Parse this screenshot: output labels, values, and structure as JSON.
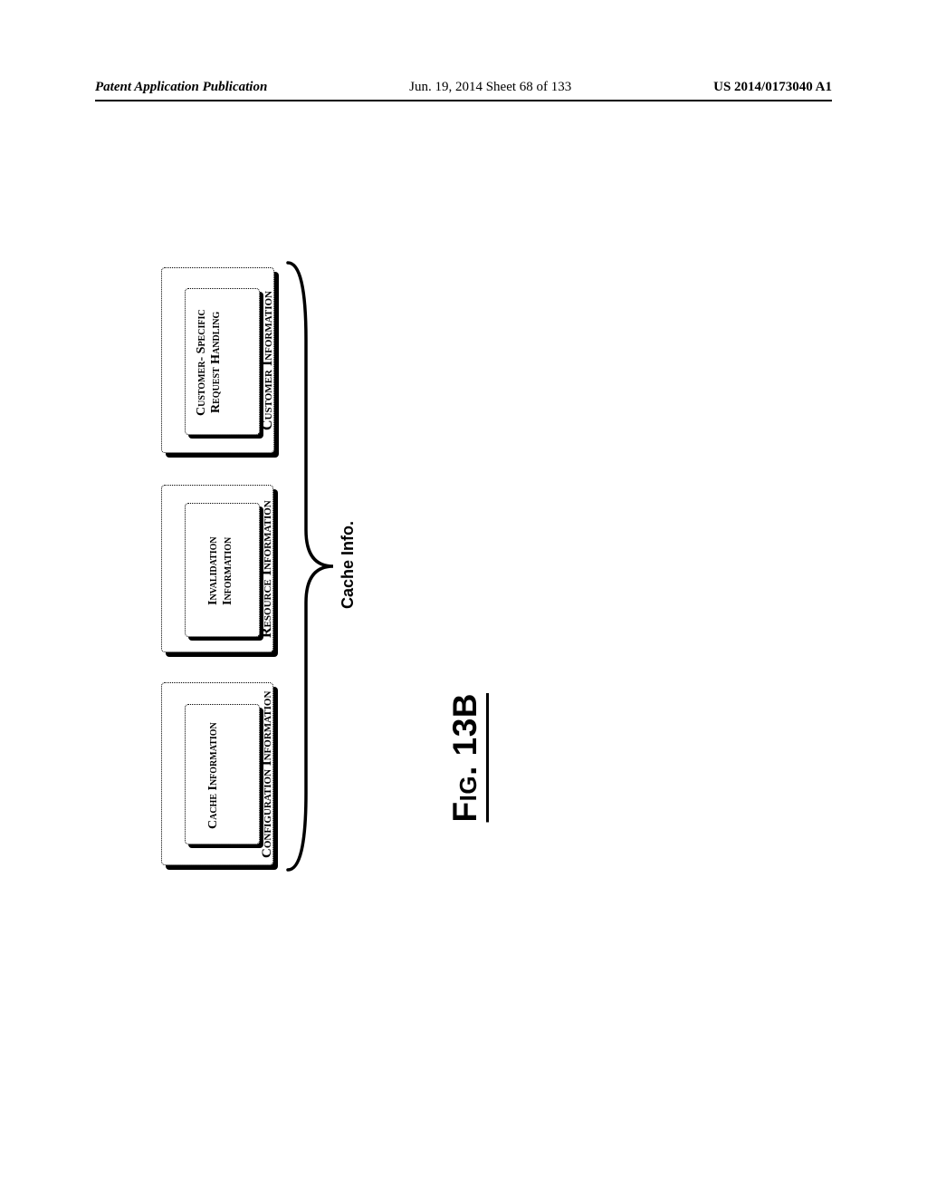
{
  "header": {
    "left": "Patent Application Publication",
    "center": "Jun. 19, 2014  Sheet 68 of 133",
    "right": "US 2014/0173040 A1"
  },
  "diagram": {
    "sections": [
      {
        "title": "Customer Information",
        "sub": "Customer-\nSpecific\nRequest\nHandling"
      },
      {
        "title": "Resource Information",
        "sub": "Invalidation\nInformation"
      },
      {
        "title": "Configuration Information",
        "sub": "Cache\nInformation"
      }
    ],
    "brace_label": "Cache\nInfo."
  },
  "figure_caption": "Fig. 13B",
  "chart_data": {
    "type": "table",
    "title": "Fig. 13B — Cache Info. structure",
    "series": [
      {
        "name": "Customer Information",
        "values": [
          "Customer-Specific Request Handling"
        ]
      },
      {
        "name": "Resource Information",
        "values": [
          "Invalidation Information"
        ]
      },
      {
        "name": "Configuration Information",
        "values": [
          "Cache Information"
        ]
      }
    ],
    "group_label": "Cache Info."
  }
}
